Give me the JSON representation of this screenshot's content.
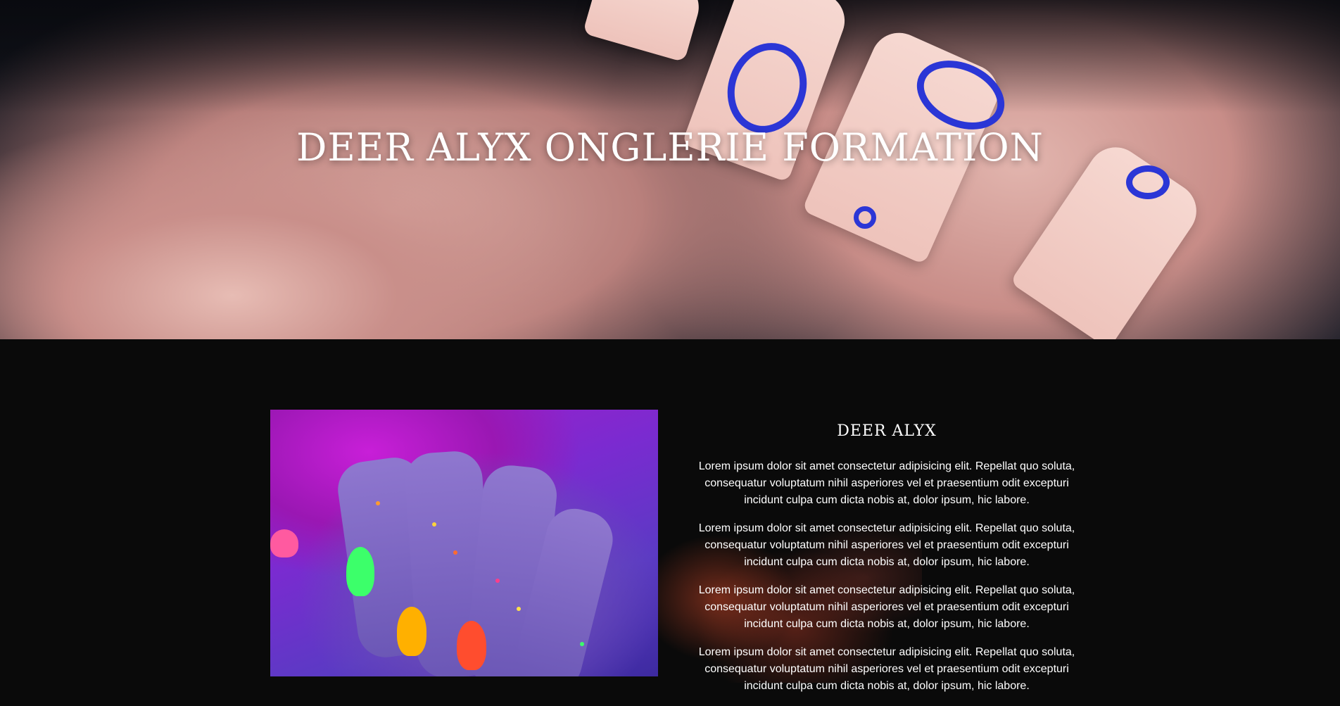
{
  "hero": {
    "title": "DEER ALYX ONGLERIE FORMATION"
  },
  "about": {
    "heading": "DEER ALYX",
    "paragraphs": [
      "Lorem ipsum dolor sit amet consectetur adipisicing elit. Repellat quo soluta, consequatur voluptatum nihil asperiores vel et praesentium odit excepturi incidunt culpa cum dicta nobis at, dolor ipsum, hic labore.",
      "Lorem ipsum dolor sit amet consectetur adipisicing elit. Repellat quo soluta, consequatur voluptatum nihil asperiores vel et praesentium odit excepturi incidunt culpa cum dicta nobis at, dolor ipsum, hic labore.",
      "Lorem ipsum dolor sit amet consectetur adipisicing elit. Repellat quo soluta, consequatur voluptatum nihil asperiores vel et praesentium odit excepturi incidunt culpa cum dicta nobis at, dolor ipsum, hic labore.",
      "Lorem ipsum dolor sit amet consectetur adipisicing elit. Repellat quo soluta, consequatur voluptatum nihil asperiores vel et praesentium odit excepturi incidunt culpa cum dicta nobis at, dolor ipsum, hic labore."
    ]
  },
  "colors": {
    "page_background": "#0a0a0a",
    "text": "#ffffff",
    "nail_accent_blue": "#2b36d6",
    "uv_purple": "#7a2bd0"
  }
}
